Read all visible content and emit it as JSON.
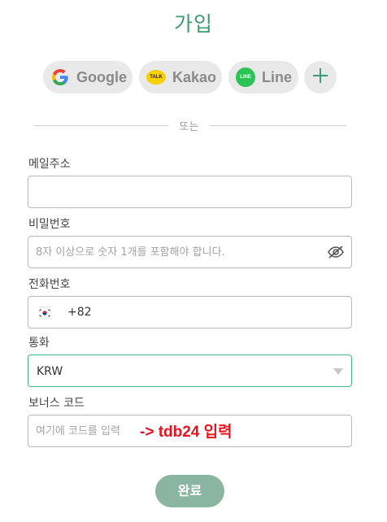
{
  "page": {
    "title": "가입"
  },
  "social": {
    "google_label": "Google",
    "kakao_label": "Kakao",
    "kakao_badge": "TALK",
    "line_label": "Line",
    "line_badge": "LINE",
    "more_label": "+"
  },
  "divider_text": "또는",
  "form": {
    "email": {
      "label": "메일주소",
      "value": "",
      "placeholder": ""
    },
    "password": {
      "label": "비밀번호",
      "value": "",
      "placeholder": "8자 이상으로 숫자 1개를 포함해야 합니다."
    },
    "phone": {
      "label": "전화번호",
      "country_code": "+82",
      "value": ""
    },
    "currency": {
      "label": "통화",
      "selected": "KRW"
    },
    "bonus": {
      "label": "보너스 코드",
      "value": "",
      "placeholder": "여기에 코드를 입력"
    }
  },
  "annotation": "-> tdb24 입력",
  "submit_label": "완료",
  "colors": {
    "brand_green": "#3e9a73",
    "submit_bg": "#8ab5a0",
    "annotation_red": "#e6141e",
    "focus_border": "#3fb58a"
  }
}
